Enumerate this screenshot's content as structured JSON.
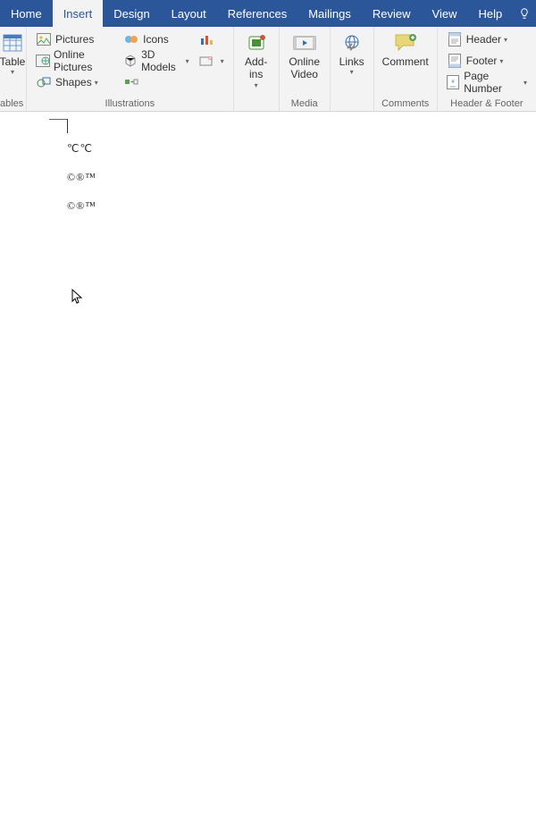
{
  "tabs": {
    "home": "Home",
    "insert": "Insert",
    "design": "Design",
    "layout": "Layout",
    "references": "References",
    "mailings": "Mailings",
    "review": "Review",
    "view": "View",
    "help": "Help"
  },
  "ribbon": {
    "tables": {
      "label": "ables",
      "table": "Table"
    },
    "illustrations": {
      "label": "Illustrations",
      "pictures": "Pictures",
      "online_pictures": "Online Pictures",
      "shapes": "Shapes",
      "icons": "Icons",
      "models": "3D Models"
    },
    "addins": {
      "label": "Add-\nins"
    },
    "media": {
      "label": "Media",
      "online_video": "Online\nVideo"
    },
    "links": {
      "label": "Links"
    },
    "comments": {
      "label": "Comments",
      "comment": "Comment"
    },
    "headerfooter": {
      "label": "Header & Footer",
      "header": "Header",
      "footer": "Footer",
      "page_number": "Page Number"
    }
  },
  "document": {
    "line1": "℃℃",
    "line2": "©®™",
    "line3": "©®™"
  }
}
